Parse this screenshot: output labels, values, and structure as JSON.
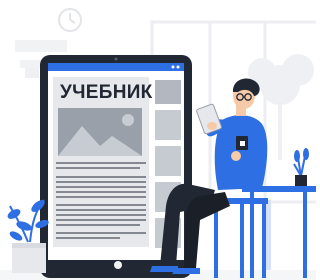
{
  "illustration": {
    "screen_heading": "УЧЕБНИК"
  },
  "colors": {
    "accent_blue": "#2f6fe4",
    "dark": "#222833",
    "background_shapes": "#f1f2f4"
  }
}
